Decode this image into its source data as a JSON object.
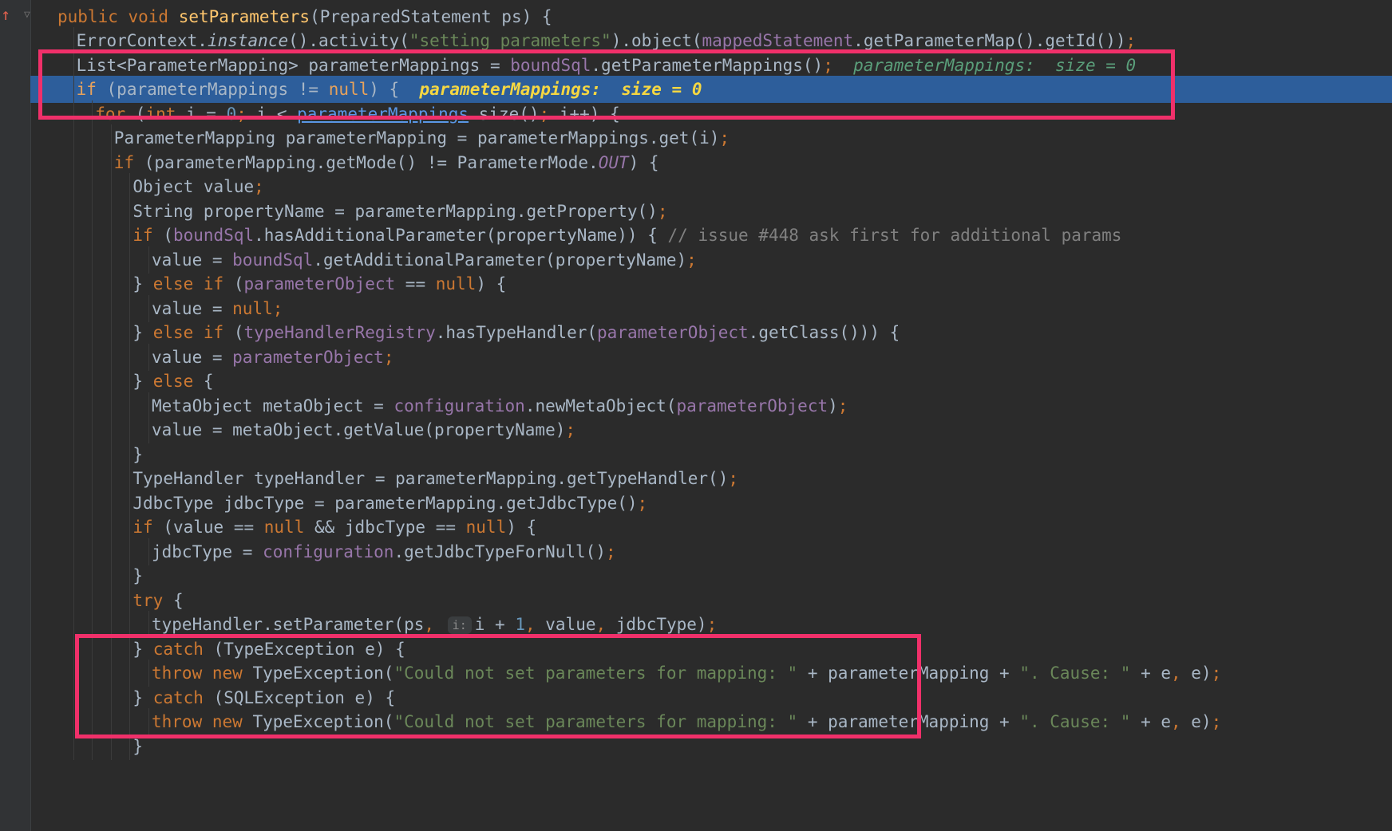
{
  "editor": {
    "gutter": {
      "breakpoint_icon": "arrow-up-icon",
      "fold_icon": "fold-shield-icon"
    },
    "colors": {
      "background": "#2b2b2b",
      "current_line": "#2d5e9b",
      "annotation_box": "#f0306a",
      "keyword": "#cc7832",
      "method": "#ffc66d",
      "field": "#9876aa",
      "number": "#6897bb",
      "string": "#6a8759",
      "comment": "#808080",
      "inline_value": "#5a9e7a"
    },
    "current_line_number": 4,
    "lines": [
      [
        [
          "kw",
          "public void "
        ],
        [
          "fn",
          "setParameters"
        ],
        [
          "p",
          "(PreparedStatement ps) {"
        ]
      ],
      [
        [
          "p",
          "ErrorContext."
        ],
        [
          "it",
          "instance"
        ],
        [
          "p",
          "().activity("
        ],
        [
          "str",
          "\"setting parameters\""
        ],
        [
          "p",
          ").object("
        ],
        [
          "fld",
          "mappedStatement"
        ],
        [
          "p",
          ".getParameterMap().getId())"
        ],
        [
          "kw",
          ";"
        ]
      ],
      [
        [
          "p",
          "List<ParameterMapping> parameterMappings = "
        ],
        [
          "fld",
          "boundSql"
        ],
        [
          "p",
          ".getParameterMappings()"
        ],
        [
          "kw",
          ";"
        ],
        [
          "p",
          "  "
        ],
        [
          "inl",
          "parameterMappings:  size = 0"
        ]
      ],
      [
        [
          "kw-cur",
          "if "
        ],
        [
          "p",
          "(parameterMappings != "
        ],
        [
          "kw-cur",
          "null"
        ],
        [
          "p",
          ") {  "
        ],
        [
          "inl-cur",
          "parameterMappings:  size = 0"
        ]
      ],
      [
        [
          "kw",
          "for "
        ],
        [
          "p",
          "("
        ],
        [
          "kw",
          "int "
        ],
        [
          "p",
          "i = "
        ],
        [
          "num",
          "0"
        ],
        [
          "kw",
          "; "
        ],
        [
          "p",
          "i < "
        ],
        [
          "link",
          "parameterMappings"
        ],
        [
          "p",
          ".size()"
        ],
        [
          "kw",
          "; "
        ],
        [
          "p",
          "i++) {"
        ]
      ],
      [
        [
          "p",
          "ParameterMapping parameterMapping = parameterMappings.get(i)"
        ],
        [
          "kw",
          ";"
        ]
      ],
      [
        [
          "kw",
          "if "
        ],
        [
          "p",
          "(parameterMapping.getMode() != ParameterMode."
        ],
        [
          "cst",
          "OUT"
        ],
        [
          "p",
          ") {"
        ]
      ],
      [
        [
          "p",
          "Object value"
        ],
        [
          "kw",
          ";"
        ]
      ],
      [
        [
          "p",
          "String propertyName = parameterMapping.getProperty()"
        ],
        [
          "kw",
          ";"
        ]
      ],
      [
        [
          "kw",
          "if "
        ],
        [
          "p",
          "("
        ],
        [
          "fld",
          "boundSql"
        ],
        [
          "p",
          ".hasAdditionalParameter(propertyName)) { "
        ],
        [
          "cmt",
          "// issue #448 ask first for additional params"
        ]
      ],
      [
        [
          "p",
          "value = "
        ],
        [
          "fld",
          "boundSql"
        ],
        [
          "p",
          ".getAdditionalParameter(propertyName)"
        ],
        [
          "kw",
          ";"
        ]
      ],
      [
        [
          "p",
          "} "
        ],
        [
          "kw",
          "else if "
        ],
        [
          "p",
          "("
        ],
        [
          "fld",
          "parameterObject "
        ],
        [
          "p",
          "== "
        ],
        [
          "kw",
          "null"
        ],
        [
          "p",
          ") {"
        ]
      ],
      [
        [
          "p",
          "value = "
        ],
        [
          "kw",
          "null;"
        ]
      ],
      [
        [
          "p",
          "} "
        ],
        [
          "kw",
          "else if "
        ],
        [
          "p",
          "("
        ],
        [
          "fld",
          "typeHandlerRegistry"
        ],
        [
          "p",
          ".hasTypeHandler("
        ],
        [
          "fld",
          "parameterObject"
        ],
        [
          "p",
          ".getClass())) {"
        ]
      ],
      [
        [
          "p",
          "value = "
        ],
        [
          "fld",
          "parameterObject"
        ],
        [
          "kw",
          ";"
        ]
      ],
      [
        [
          "p",
          "} "
        ],
        [
          "kw",
          "else "
        ],
        [
          "p",
          "{"
        ]
      ],
      [
        [
          "p",
          "MetaObject metaObject = "
        ],
        [
          "fld",
          "configuration"
        ],
        [
          "p",
          ".newMetaObject("
        ],
        [
          "fld",
          "parameterObject"
        ],
        [
          "p",
          ")"
        ],
        [
          "kw",
          ";"
        ]
      ],
      [
        [
          "p",
          "value = metaObject.getValue(propertyName)"
        ],
        [
          "kw",
          ";"
        ]
      ],
      [
        [
          "p",
          "}"
        ]
      ],
      [
        [
          "p",
          "TypeHandler typeHandler = parameterMapping.getTypeHandler()"
        ],
        [
          "kw",
          ";"
        ]
      ],
      [
        [
          "p",
          "JdbcType jdbcType = parameterMapping.getJdbcType()"
        ],
        [
          "kw",
          ";"
        ]
      ],
      [
        [
          "kw",
          "if "
        ],
        [
          "p",
          "(value == "
        ],
        [
          "kw",
          "null "
        ],
        [
          "p",
          "&& jdbcType == "
        ],
        [
          "kw",
          "null"
        ],
        [
          "p",
          ") {"
        ]
      ],
      [
        [
          "p",
          "jdbcType = "
        ],
        [
          "fld",
          "configuration"
        ],
        [
          "p",
          ".getJdbcTypeForNull()"
        ],
        [
          "kw",
          ";"
        ]
      ],
      [
        [
          "p",
          "}"
        ]
      ],
      [
        [
          "kw",
          "try "
        ],
        [
          "p",
          "{"
        ]
      ],
      [
        [
          "p",
          "typeHandler.setParameter(ps"
        ],
        [
          "kw",
          ", "
        ],
        [
          "hint",
          "i:"
        ],
        [
          "p",
          "i + "
        ],
        [
          "num",
          "1"
        ],
        [
          "kw",
          ", "
        ],
        [
          "p",
          "value"
        ],
        [
          "kw",
          ", "
        ],
        [
          "p",
          "jdbcType)"
        ],
        [
          "kw",
          ";"
        ]
      ],
      [
        [
          "p",
          "} "
        ],
        [
          "kw",
          "catch "
        ],
        [
          "p",
          "(TypeException e) {"
        ]
      ],
      [
        [
          "kw",
          "throw new "
        ],
        [
          "p",
          "TypeException("
        ],
        [
          "str",
          "\"Could not set parameters for mapping: \" "
        ],
        [
          "p",
          "+ parameterMapping + "
        ],
        [
          "str",
          "\". Cause: \" "
        ],
        [
          "p",
          "+ e"
        ],
        [
          "kw",
          ", "
        ],
        [
          "p",
          "e)"
        ],
        [
          "kw",
          ";"
        ]
      ],
      [
        [
          "p",
          "} "
        ],
        [
          "kw",
          "catch "
        ],
        [
          "p",
          "(SQLException e) {"
        ]
      ],
      [
        [
          "kw",
          "throw new "
        ],
        [
          "p",
          "TypeException("
        ],
        [
          "str",
          "\"Could not set parameters for mapping: \" "
        ],
        [
          "p",
          "+ parameterMapping + "
        ],
        [
          "str",
          "\". Cause: \" "
        ],
        [
          "p",
          "+ e"
        ],
        [
          "kw",
          ", "
        ],
        [
          "p",
          "e)"
        ],
        [
          "kw",
          ";"
        ]
      ],
      [
        [
          "p",
          "}"
        ]
      ]
    ]
  }
}
